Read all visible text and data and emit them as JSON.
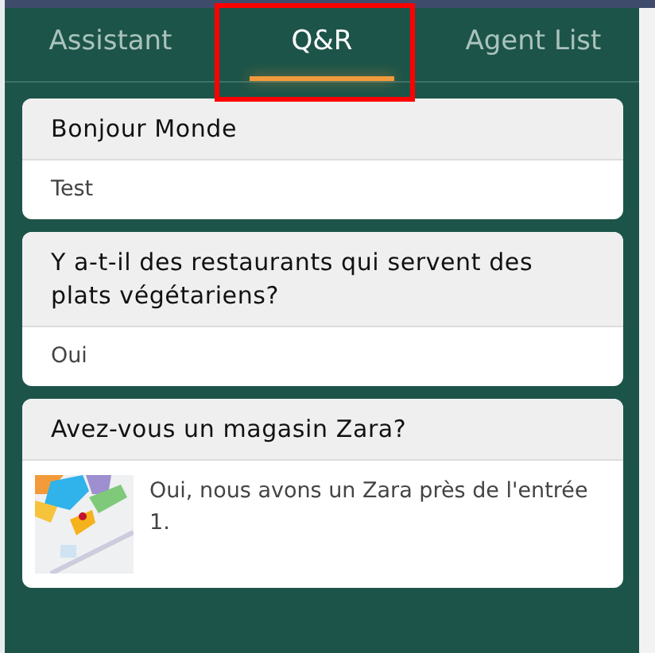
{
  "tabs": [
    {
      "label": "Assistant",
      "selected": false,
      "highlighted": false
    },
    {
      "label": "Q&R",
      "selected": true,
      "highlighted": true
    },
    {
      "label": "Agent List",
      "selected": false,
      "highlighted": false
    }
  ],
  "cards": [
    {
      "question": "Bonjour Monde",
      "answer": "Test"
    },
    {
      "question": "Y a-t-il des restaurants qui servent des plats végétariens?",
      "answer": "Oui"
    },
    {
      "question": "Avez-vous un magasin Zara?",
      "answer": "Oui, nous avons un Zara près de l'entrée 1."
    }
  ]
}
